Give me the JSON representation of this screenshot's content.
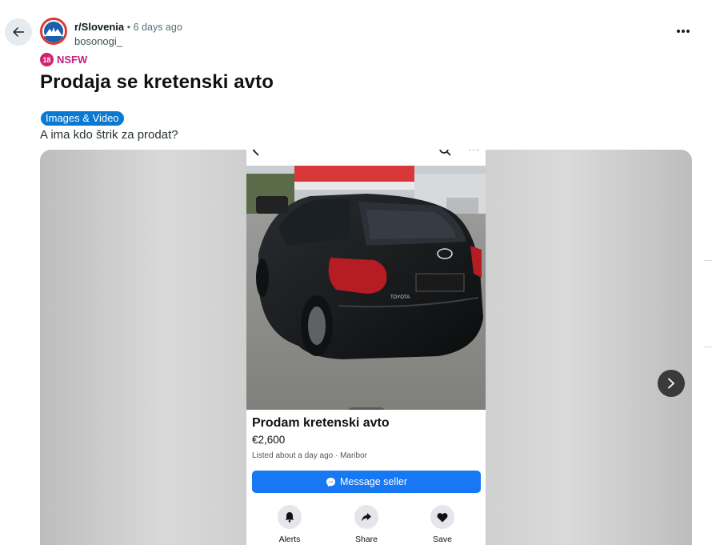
{
  "post": {
    "subreddit": "r/Slovenia",
    "time": "• 6 days ago",
    "author": "bosonogi_",
    "nsfw_badge": "18",
    "nsfw_label": "NSFW",
    "title": "Prodaja se kretenski avto",
    "flair": "Images & Video",
    "body": "A ima kdo štrik za prodat?"
  },
  "listing": {
    "title": "Prodam kretenski avto",
    "price": "€2,600",
    "meta": "Listed about a day ago · Maribor",
    "message_button": "Message seller",
    "plate_brand": "TOYOTA",
    "actions": [
      {
        "label": "Alerts",
        "icon": "bell-icon"
      },
      {
        "label": "Share",
        "icon": "share-icon"
      },
      {
        "label": "Save",
        "icon": "heart-icon"
      }
    ]
  },
  "colors": {
    "nsfw": "#d4206d",
    "flair": "#0a79d1",
    "messenger": "#1877f2",
    "avatar_ring": "#d93a2b"
  }
}
